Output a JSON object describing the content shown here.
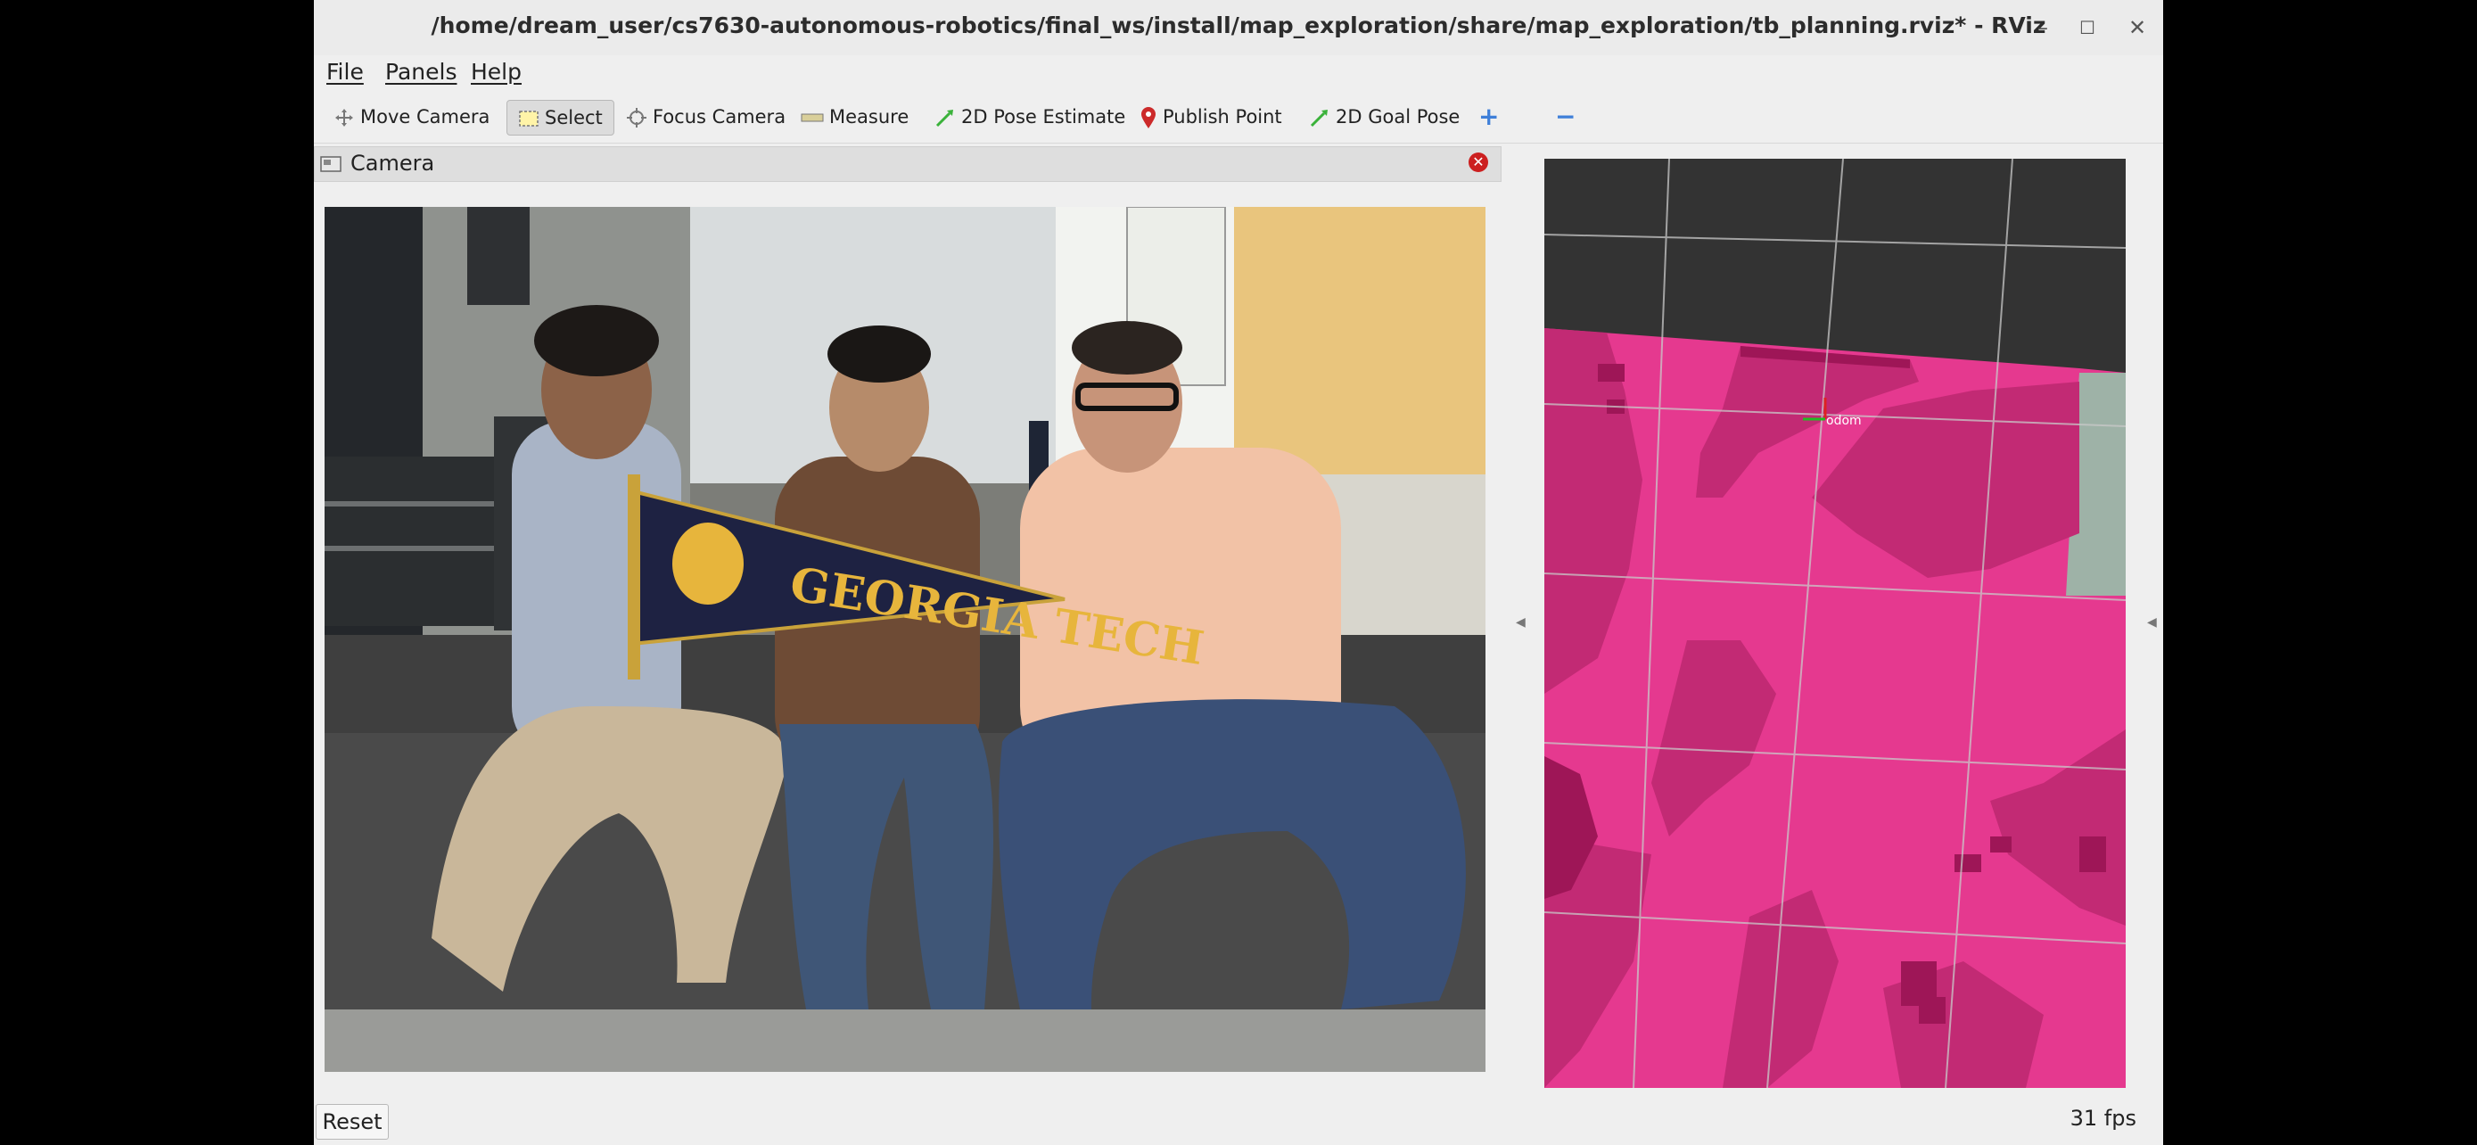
{
  "window": {
    "title": "/home/dream_user/cs7630-autonomous-robotics/final_ws/install/map_exploration/share/map_exploration/tb_planning.rviz* - RViz",
    "minimize_glyph": "–",
    "maximize_glyph": "☐",
    "close_glyph": "✕"
  },
  "menu": {
    "file": "File",
    "panels": "Panels",
    "help": "Help"
  },
  "toolbar": {
    "tools": [
      {
        "label": "Move Camera",
        "icon": "move-camera-icon"
      },
      {
        "label": "Select",
        "icon": "select-icon",
        "active": true
      },
      {
        "label": "Focus Camera",
        "icon": "focus-camera-icon"
      },
      {
        "label": "Measure",
        "icon": "measure-icon"
      },
      {
        "label": "2D Pose Estimate",
        "icon": "pose-estimate-icon"
      },
      {
        "label": "Publish Point",
        "icon": "publish-point-icon"
      },
      {
        "label": "2D Goal Pose",
        "icon": "goal-pose-icon"
      }
    ],
    "add_glyph": "+",
    "remove_glyph": "−"
  },
  "camera_panel": {
    "title": "Camera",
    "close_glyph": "✕",
    "pennant_text": "GEORGIA TECH"
  },
  "map_view": {
    "robot_label": "odom",
    "colors": {
      "unknown": "#333333",
      "free": "#e5398f",
      "occupied": "#9e1657",
      "cost": "#c22a74",
      "gray": "#9eb2a7"
    }
  },
  "status": {
    "reset": "Reset",
    "fps": "31 fps"
  }
}
